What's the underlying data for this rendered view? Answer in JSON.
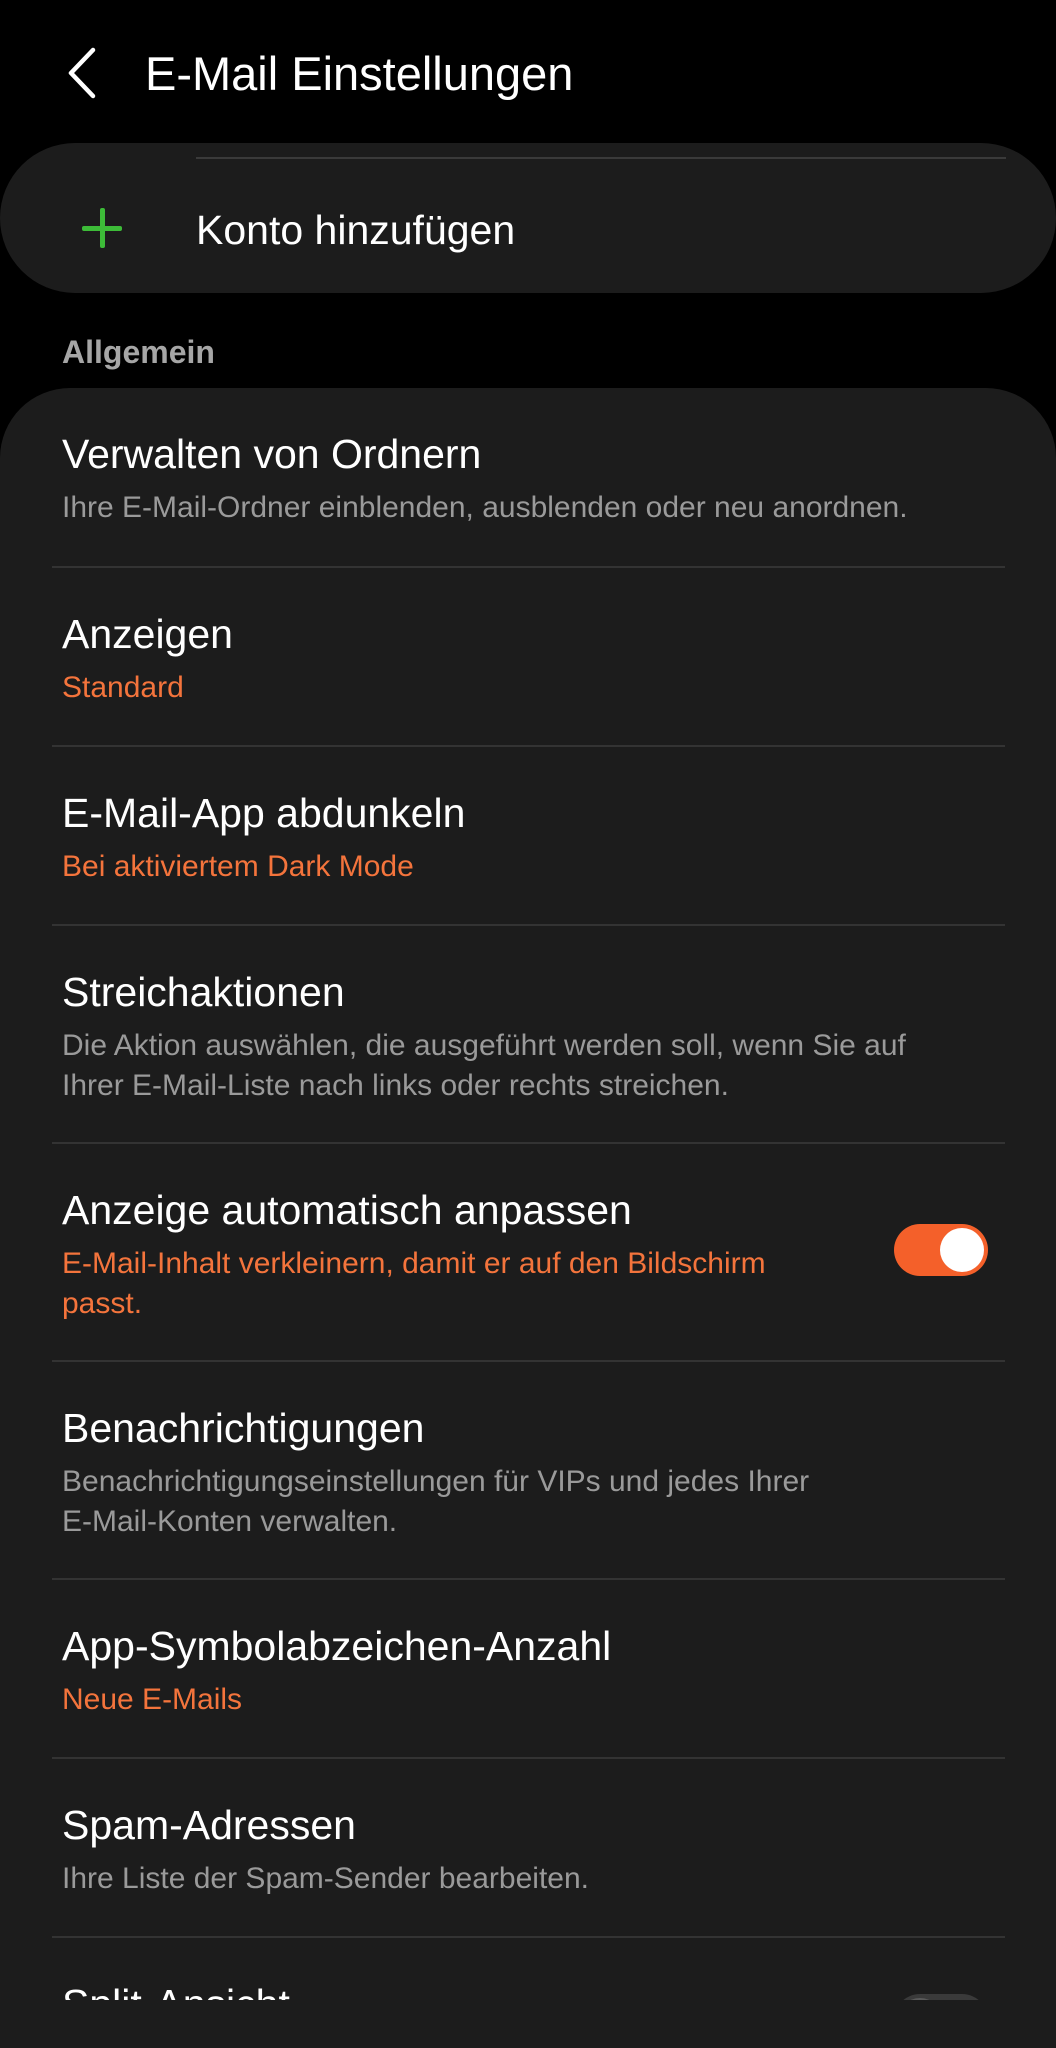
{
  "header": {
    "title": "E-Mail Einstellungen",
    "back_icon": "chevron-left-icon"
  },
  "add_account": {
    "label": "Konto hinzufügen",
    "icon": "plus-icon",
    "icon_color": "#3dbb38"
  },
  "section": {
    "label": "Allgemein"
  },
  "colors": {
    "accent": "#f4743c",
    "toggle_on": "#f4602a",
    "background": "#000000",
    "card": "#1c1c1c"
  },
  "settings": {
    "manage_folders": {
      "title": "Verwalten von Ordnern",
      "subtitle": "Ihre E-Mail-Ordner einblenden, ausblenden oder neu anordnen."
    },
    "display": {
      "title": "Anzeigen",
      "value": "Standard"
    },
    "dark_mode": {
      "title": "E-Mail-App abdunkeln",
      "value": "Bei aktiviertem Dark Mode"
    },
    "swipe_actions": {
      "title": "Streichaktionen",
      "subtitle_line1": "Die Aktion auswählen, die ausgeführt werden soll, wenn Sie auf",
      "subtitle_line2": "Ihrer E-Mail-Liste nach links oder rechts streichen."
    },
    "auto_fit": {
      "title": "Anzeige automatisch anpassen",
      "value_line1": "E-Mail-Inhalt verkleinern, damit er auf den Bildschirm",
      "value_line2": "passt.",
      "enabled": true
    },
    "notifications": {
      "title": "Benachrichtigungen",
      "subtitle_line1": "Benachrichtigungseinstellungen für VIPs und jedes Ihrer",
      "subtitle_line2": "E-Mail-Konten verwalten."
    },
    "badge_count": {
      "title": "App-Symbolabzeichen-Anzahl",
      "value": "Neue E-Mails"
    },
    "spam": {
      "title": "Spam-Adressen",
      "subtitle": "Ihre Liste der Spam-Sender bearbeiten."
    },
    "split_view": {
      "title": "Split-Ansicht",
      "enabled": false
    }
  }
}
